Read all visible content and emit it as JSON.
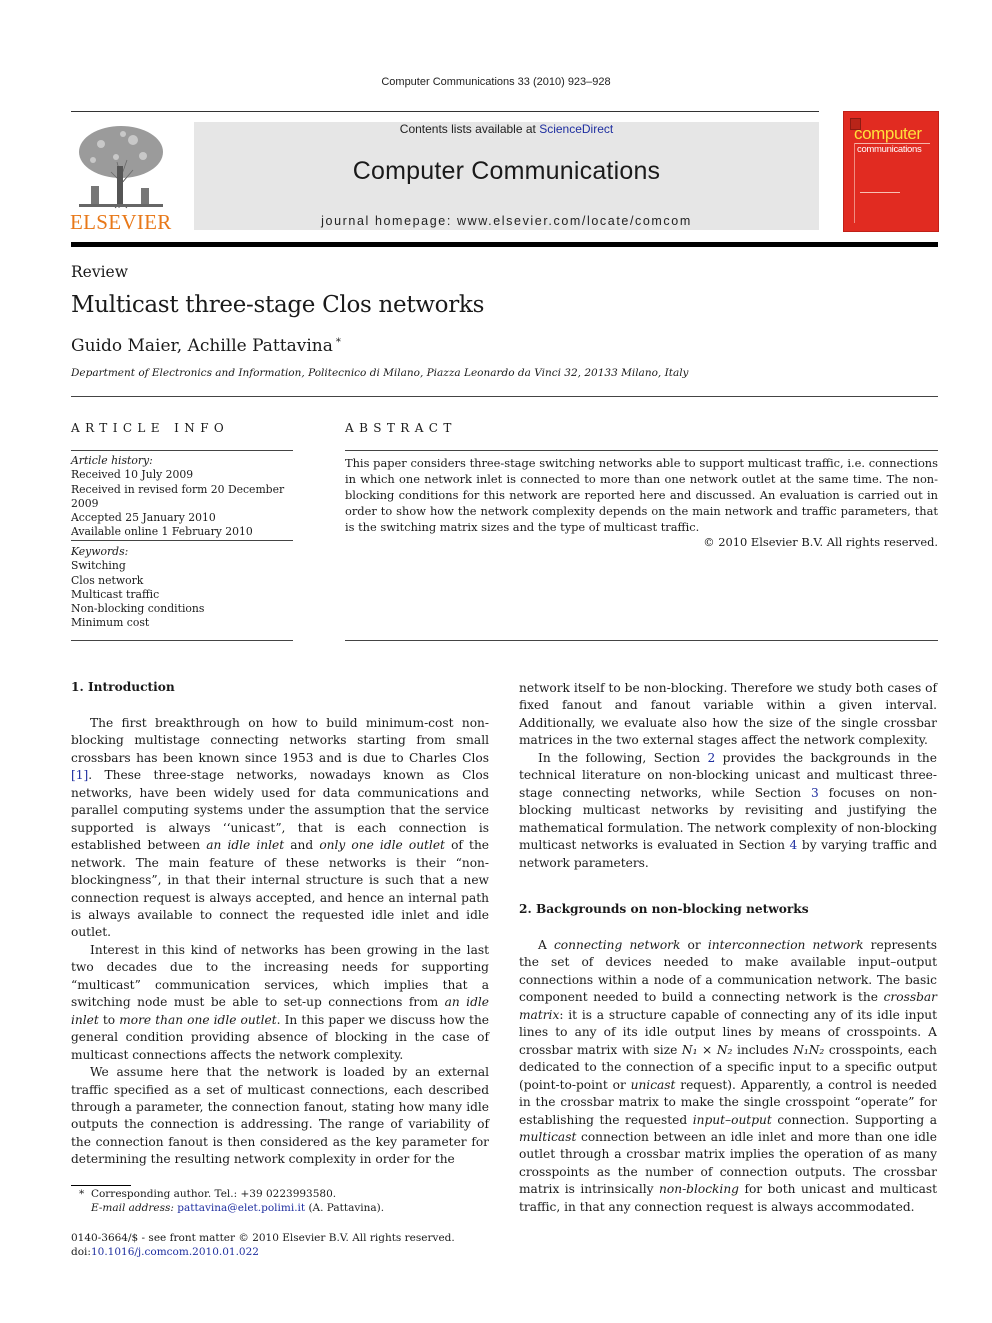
{
  "running_head": "Computer Communications 33 (2010) 923–928",
  "masthead": {
    "contents_prefix": "Contents lists available at ",
    "contents_link": "ScienceDirect",
    "journal_title": "Computer Communications",
    "homepage": "journal homepage: www.elsevier.com/locate/comcom",
    "publisher_logo_text": "ELSEVIER",
    "cover_title_1": "computer",
    "cover_title_2": "communications"
  },
  "article": {
    "type": "Review",
    "title": "Multicast three-stage Clos networks",
    "authors": "Guido Maier, Achille Pattavina",
    "corresponding_mark": "*",
    "affiliation": "Department of Electronics and Information, Politecnico di Milano, Piazza Leonardo da Vinci 32, 20133 Milano, Italy"
  },
  "article_info": {
    "header": "ARTICLE INFO",
    "history_label": "Article history:",
    "history": [
      "Received 10 July 2009",
      "Received in revised form 20 December 2009",
      "Accepted 25 January 2010",
      "Available online 1 February 2010"
    ],
    "keywords_label": "Keywords:",
    "keywords": [
      "Switching",
      "Clos network",
      "Multicast traffic",
      "Non-blocking conditions",
      "Minimum cost"
    ]
  },
  "abstract": {
    "header": "ABSTRACT",
    "text": "This paper considers three-stage switching networks able to support multicast traffic, i.e. connections in which one network inlet is connected to more than one network outlet at the same time. The non-blocking conditions for this network are reported here and discussed. An evaluation is carried out in order to show how the network complexity depends on the main network and traffic parameters, that is the switching matrix sizes and the type of multicast traffic.",
    "copyright": "© 2010 Elsevier B.V. All rights reserved."
  },
  "section1": {
    "heading": "1. Introduction",
    "p1_a": "The first breakthrough on how to build minimum-cost non-blocking multistage connecting networks starting from small crossbars has been known since 1953 and is due to Charles Clos ",
    "p1_ref": "[1]",
    "p1_b": ". These three-stage networks, nowadays known as Clos networks, have been widely used for data communications and parallel computing systems under the assumption that the service supported is always ‘‘unicast”, that is each connection is established between ",
    "p1_em1": "an idle inlet",
    "p1_c": " and ",
    "p1_em2": "only one idle outlet",
    "p1_d": " of the network. The main feature of these networks is their “non-blockingness”, in that their internal structure is such that a new connection request is always accepted, and hence an internal path is always available to connect the requested idle inlet and idle outlet.",
    "p2_a": "Interest in this kind of networks has been growing in the last two decades due to the increasing needs for supporting “multicast” communication services, which implies that a switching node must be able to set-up connections from ",
    "p2_em1": "an idle inlet",
    "p2_b": " to ",
    "p2_em2": "more than one idle outlet",
    "p2_c": ". In this paper we discuss how the general condition providing absence of blocking in the case of multicast connections affects the network complexity.",
    "p3": "We assume here that the network is loaded by an external traffic specified as a set of multicast connections, each described through a parameter, the connection fanout, stating how many idle outputs the connection is addressing. The range of variability of the connection fanout is then considered as the key parameter for determining the resulting network complexity in order for the",
    "p3_cont": "network itself to be non-blocking. Therefore we study both cases of fixed fanout and fanout variable within a given interval. Additionally, we evaluate also how the size of the single crossbar matrices in the two external stages affect the network complexity.",
    "p4_a": "In the following, Section ",
    "p4_ref1": "2",
    "p4_b": " provides the backgrounds in the technical literature on non-blocking unicast and multicast three-stage connecting networks, while Section ",
    "p4_ref2": "3",
    "p4_c": " focuses on non-blocking multicast networks by revisiting and justifying the mathematical formulation. The network complexity of non-blocking multicast networks is evaluated in Section ",
    "p4_ref3": "4",
    "p4_d": " by varying traffic and network parameters."
  },
  "section2": {
    "heading": "2. Backgrounds on non-blocking networks",
    "p1_a": "A ",
    "p1_em1": "connecting network",
    "p1_b": " or ",
    "p1_em2": "interconnection network",
    "p1_c": " represents the set of devices needed to make available input–output connections within a node of a communication network. The basic component needed to build a connecting network is the ",
    "p1_em3": "crossbar matrix",
    "p1_d": ": it is a structure capable of connecting any of its idle input lines to any of its idle output lines by means of crosspoints. A crossbar matrix with size ",
    "p1_math1": "N₁ × N₂",
    "p1_e": " includes ",
    "p1_math2": "N₁N₂",
    "p1_f": " crosspoints, each dedicated to the connection of a specific input to a specific output (point-to-point or ",
    "p1_em4": "unicast",
    "p1_g": " request). Apparently, a control is needed in the crossbar matrix to make the single crosspoint “operate” for establishing the requested ",
    "p1_em5": "input–output",
    "p1_h": " connection. Supporting a ",
    "p1_em6": "multicast",
    "p1_i": " connection between an idle inlet and more than one idle outlet through a crossbar matrix implies the operation of as many crosspoints as the number of connection outputs. The crossbar matrix is intrinsically ",
    "p1_em7": "non-blocking",
    "p1_j": " for both unicast and multicast traffic, in that any connection request is always accommodated."
  },
  "footnote": {
    "mark": "*",
    "line1": "Corresponding author. Tel.: +39 0223993580.",
    "email_label": "E-mail address:",
    "email": "pattavina@elet.polimi.it",
    "email_suffix": " (A. Pattavina)."
  },
  "front_matter": {
    "issn_line": "0140-3664/$ - see front matter © 2010 Elsevier B.V. All rights reserved.",
    "doi_prefix": "doi:",
    "doi": "10.1016/j.comcom.2010.01.022"
  }
}
